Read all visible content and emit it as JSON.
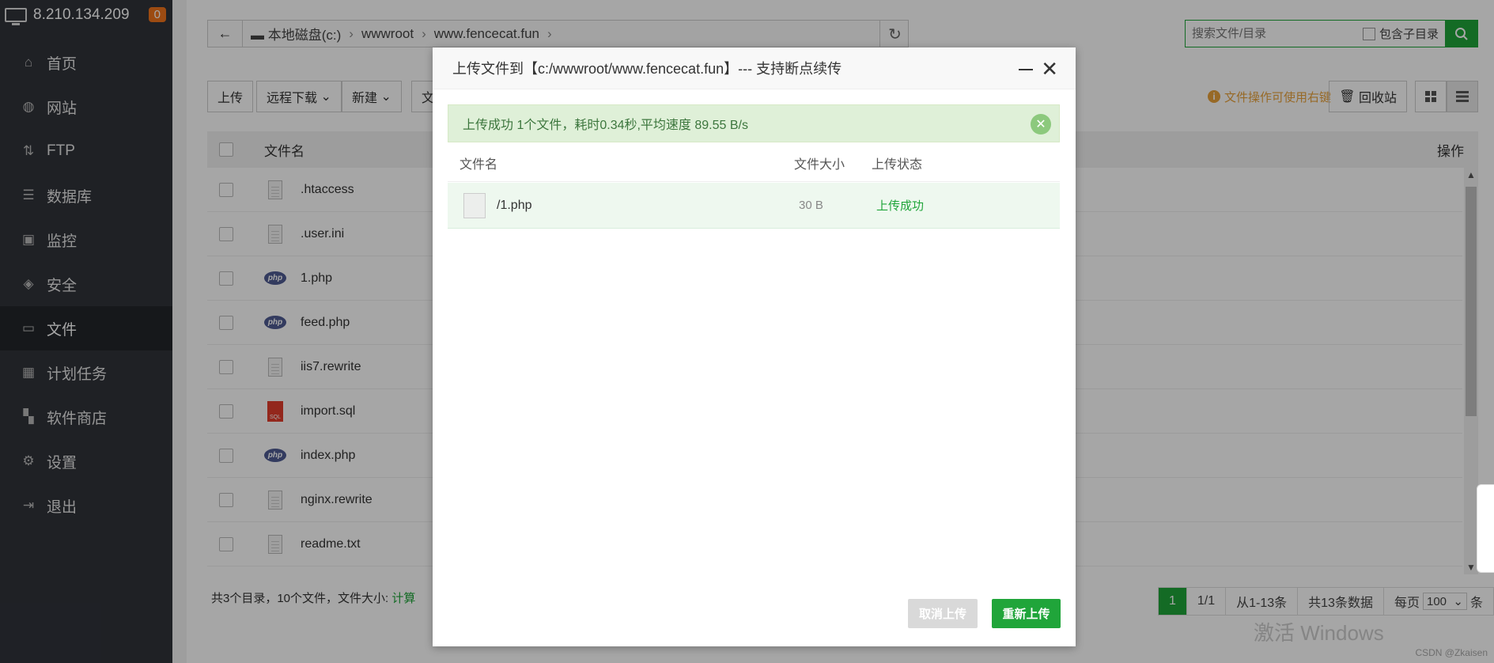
{
  "server": {
    "ip": "8.210.134.209",
    "badge": "0"
  },
  "sidebar": {
    "items": [
      {
        "label": "首页",
        "icon": "home-icon"
      },
      {
        "label": "网站",
        "icon": "globe-icon"
      },
      {
        "label": "FTP",
        "icon": "ftp-icon"
      },
      {
        "label": "数据库",
        "icon": "database-icon"
      },
      {
        "label": "监控",
        "icon": "monitor-icon"
      },
      {
        "label": "安全",
        "icon": "shield-icon"
      },
      {
        "label": "文件",
        "icon": "folder-icon"
      },
      {
        "label": "计划任务",
        "icon": "calendar-icon"
      },
      {
        "label": "软件商店",
        "icon": "grid-icon"
      },
      {
        "label": "设置",
        "icon": "gear-icon"
      },
      {
        "label": "退出",
        "icon": "logout-icon"
      }
    ],
    "active": "文件"
  },
  "path": {
    "segments": [
      "本地磁盘(c:)",
      "wwwroot",
      "www.fencecat.fun"
    ]
  },
  "search": {
    "placeholder": "搜索文件/目录",
    "subdir_label": "包含子目录"
  },
  "toolbar": {
    "upload": "上传",
    "remote_download": "远程下载",
    "new": "新建",
    "partial": "文",
    "hint": "文件操作可使用右键",
    "recycle": "回收站"
  },
  "table": {
    "col_name": "文件名",
    "col_ops": "操作",
    "rows": [
      {
        "name": ".htaccess",
        "icon": "text-file-icon"
      },
      {
        "name": ".user.ini",
        "icon": "text-file-icon"
      },
      {
        "name": "1.php",
        "icon": "php-file-icon"
      },
      {
        "name": "feed.php",
        "icon": "php-file-icon"
      },
      {
        "name": "iis7.rewrite",
        "icon": "text-file-icon"
      },
      {
        "name": "import.sql",
        "icon": "sql-file-icon"
      },
      {
        "name": "index.php",
        "icon": "php-file-icon"
      },
      {
        "name": "nginx.rewrite",
        "icon": "text-file-icon"
      },
      {
        "name": "readme.txt",
        "icon": "text-file-icon"
      }
    ]
  },
  "footer": {
    "summary": "共3个目录，10个文件，文件大小:",
    "calc": "计算"
  },
  "pager": {
    "current": "1",
    "pages": "1/1",
    "range": "从1-13条",
    "total": "共13条数据",
    "per_page_label": "每页",
    "per_page": "100",
    "unit": "条"
  },
  "watermark": "激活 Windows",
  "credit": "CSDN @Zkaisen",
  "modal": {
    "title": "上传文件到【c:/wwwroot/www.fencecat.fun】--- 支持断点续传",
    "alert": "上传成功 1个文件，耗时0.34秒,平均速度 89.55 B/s",
    "headers": {
      "name": "文件名",
      "size": "文件大小",
      "status": "上传状态"
    },
    "file": {
      "name": "/1.php",
      "size": "30 B",
      "status": "上传成功"
    },
    "cancel": "取消上传",
    "reupload": "重新上传"
  },
  "colors": {
    "accent": "#20a53a",
    "sidebar_bg": "#30333a",
    "success_bg": "#dff0d8"
  }
}
